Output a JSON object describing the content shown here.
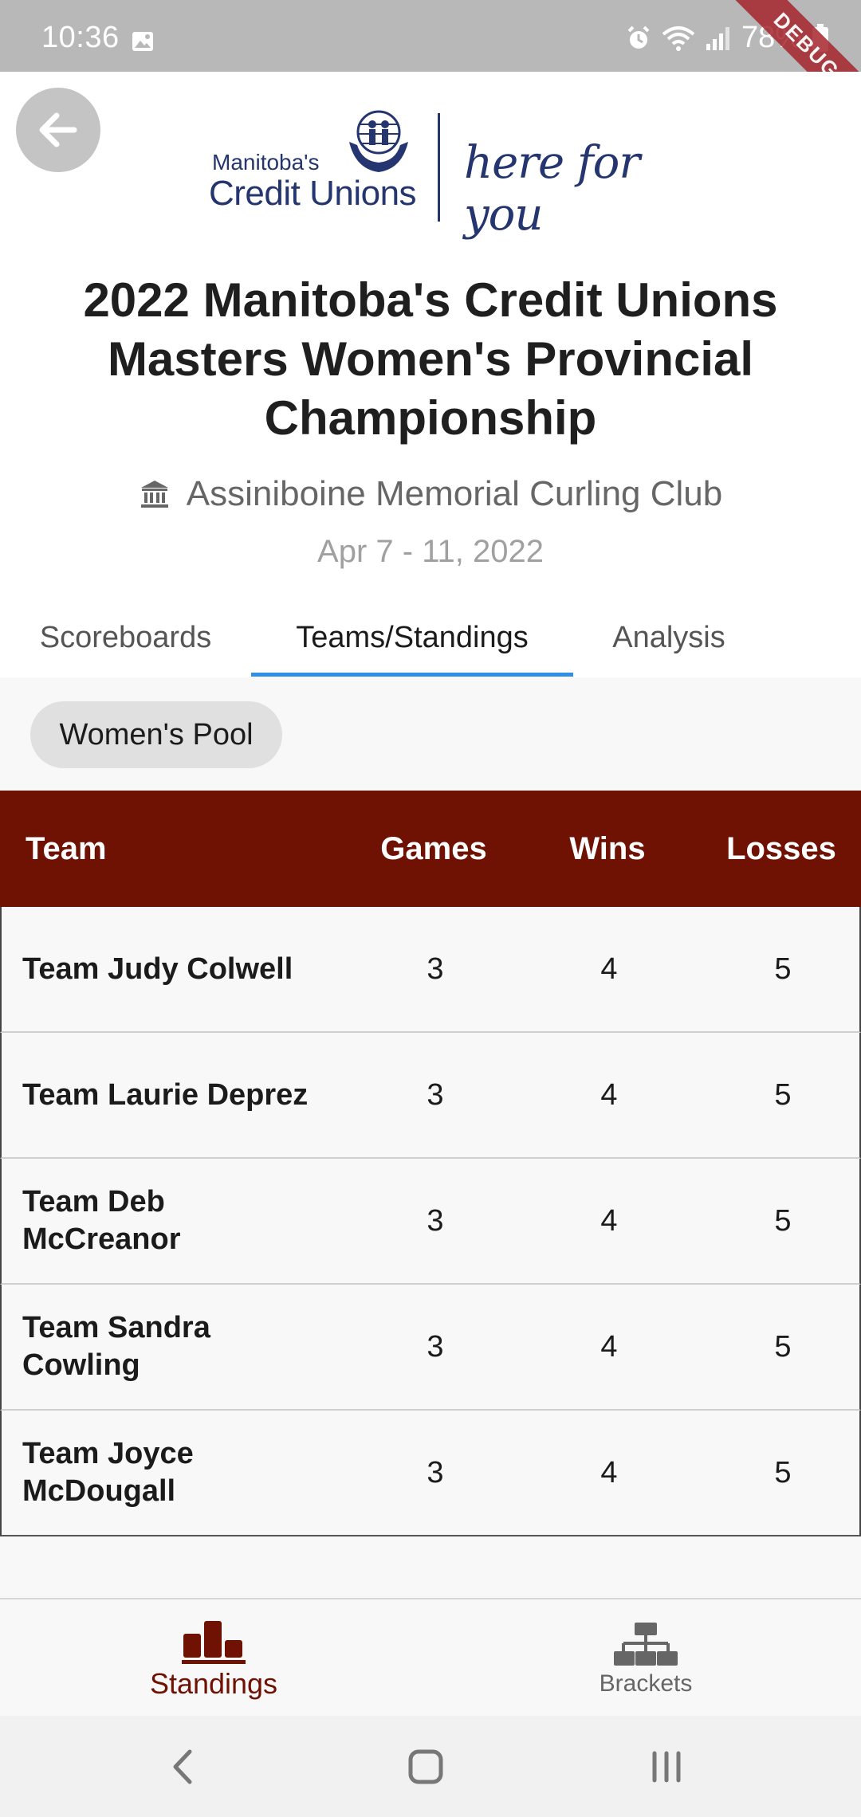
{
  "status_bar": {
    "time": "10:36",
    "battery": "78%",
    "icons": [
      "image-icon",
      "alarm-icon",
      "wifi-icon",
      "signal-icon",
      "battery-icon"
    ],
    "debug_banner": "DEBUG"
  },
  "header": {
    "back_icon": "arrow-left-icon",
    "logo": {
      "small_text": "Manitoba's",
      "main_text": "Credit Unions",
      "tagline": "here for you"
    },
    "title": "2022 Manitoba's Credit Unions Masters Women's Provincial Championship",
    "venue": "Assiniboine Memorial Curling Club",
    "venue_icon": "building-icon",
    "dates": "Apr 7 - 11, 2022"
  },
  "tabs": [
    {
      "label": "Scoreboards",
      "active": false
    },
    {
      "label": "Teams/Standings",
      "active": true
    },
    {
      "label": "Analysis",
      "active": false
    }
  ],
  "filter_chip": "Women's Pool",
  "table": {
    "columns": [
      "Team",
      "Games",
      "Wins",
      "Losses"
    ],
    "rows": [
      {
        "team": "Team Judy Colwell",
        "games": "3",
        "wins": "4",
        "losses": "5"
      },
      {
        "team": "Team Laurie Deprez",
        "games": "3",
        "wins": "4",
        "losses": "5"
      },
      {
        "team": "Team Deb McCreanor",
        "games": "3",
        "wins": "4",
        "losses": "5"
      },
      {
        "team": "Team Sandra Cowling",
        "games": "3",
        "wins": "4",
        "losses": "5"
      },
      {
        "team": "Team Joyce McDougall",
        "games": "3",
        "wins": "4",
        "losses": "5"
      }
    ]
  },
  "bottom_nav": [
    {
      "label": "Standings",
      "icon": "podium-icon",
      "active": true
    },
    {
      "label": "Brackets",
      "icon": "bracket-tree-icon",
      "active": false
    }
  ],
  "colors": {
    "header_bg": "#6f1103",
    "accent_active_tab": "#2f8ee5",
    "brand_navy": "#24356f",
    "active_nav": "#6f1103"
  }
}
